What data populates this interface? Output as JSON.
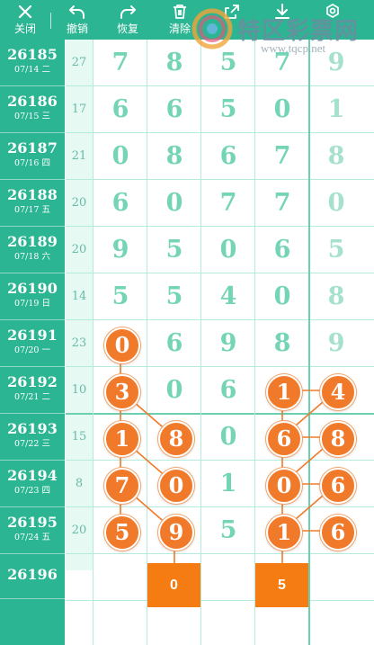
{
  "toolbar": {
    "buttons": [
      {
        "id": "close",
        "label": "关闭",
        "icon": "close-icon"
      },
      {
        "id": "undo",
        "label": "撤销",
        "icon": "undo-icon"
      },
      {
        "id": "redo",
        "label": "恢复",
        "icon": "redo-icon"
      },
      {
        "id": "clear",
        "label": "清除",
        "icon": "trash-icon"
      },
      {
        "id": "share",
        "label": "",
        "icon": "share-icon"
      },
      {
        "id": "download",
        "label": "",
        "icon": "download-icon"
      },
      {
        "id": "settings",
        "label": "",
        "icon": "settings-icon"
      }
    ]
  },
  "watermark": {
    "title": "特区彩票网",
    "url": "www.tqcp.net"
  },
  "rows": [
    {
      "period": "26185",
      "date": "07/14 二",
      "sum": "27",
      "digits": [
        "7",
        "8",
        "5",
        "7",
        "9"
      ]
    },
    {
      "period": "26186",
      "date": "07/15 三",
      "sum": "17",
      "digits": [
        "6",
        "6",
        "5",
        "0",
        "1"
      ]
    },
    {
      "period": "26187",
      "date": "07/16 四",
      "sum": "21",
      "digits": [
        "0",
        "8",
        "6",
        "7",
        "8"
      ]
    },
    {
      "period": "26188",
      "date": "07/17 五",
      "sum": "20",
      "digits": [
        "6",
        "0",
        "7",
        "7",
        "0"
      ]
    },
    {
      "period": "26189",
      "date": "07/18 六",
      "sum": "20",
      "digits": [
        "9",
        "5",
        "0",
        "6",
        "5"
      ]
    },
    {
      "period": "26190",
      "date": "07/19 日",
      "sum": "14",
      "digits": [
        "5",
        "5",
        "4",
        "0",
        "8"
      ]
    },
    {
      "period": "26191",
      "date": "07/20 一",
      "sum": "23",
      "digits": [
        "0",
        "6",
        "9",
        "8",
        "9"
      ]
    },
    {
      "period": "26192",
      "date": "07/21 二",
      "sum": "10",
      "digits": [
        "3",
        "0",
        "6",
        "1",
        "4"
      ]
    },
    {
      "period": "26193",
      "date": "07/22 三",
      "sum": "15",
      "digits": [
        "1",
        "8",
        "0",
        "6",
        "8"
      ]
    },
    {
      "period": "26194",
      "date": "07/23 四",
      "sum": "8",
      "digits": [
        "7",
        "0",
        "1",
        "0",
        "6"
      ]
    },
    {
      "period": "26195",
      "date": "07/24 五",
      "sum": "20",
      "digits": [
        "5",
        "9",
        "5",
        "1",
        "6"
      ]
    }
  ],
  "next": {
    "period": "26196",
    "picks": [
      "0",
      "5"
    ]
  },
  "colors": {
    "green": "#2bb592",
    "orange": "#f07a2a",
    "pick": "#f57c12"
  }
}
